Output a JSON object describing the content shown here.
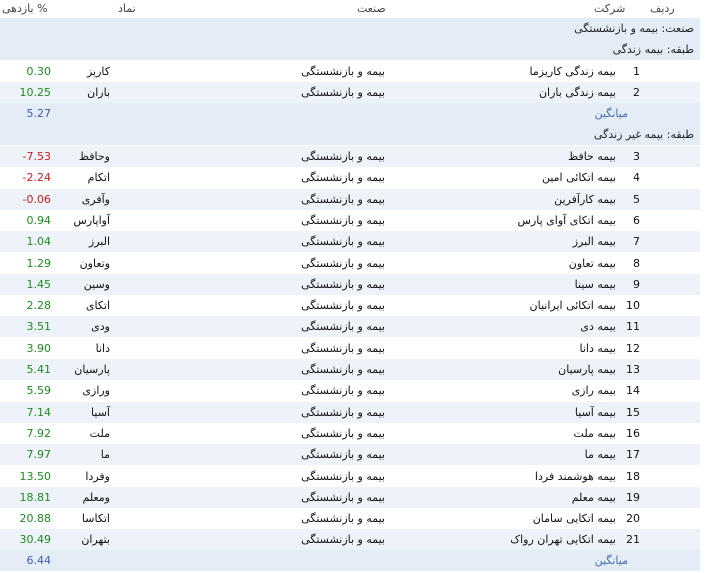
{
  "header": {
    "col_return": "بازدهی %",
    "col_symbol": "نماد",
    "col_industry": "صنعت",
    "col_company": "شرکت",
    "col_row": "ردیف"
  },
  "industry_group": "صنعت: بیمه و بازنشستگی",
  "class_life": "طبقه: بیمه زندگی",
  "class_nonlife": "طبقه: بیمه غیر زندگی",
  "average_label": "میانگین",
  "life_average": "5.27",
  "nonlife_average": "6.44",
  "industry_name": "بیمه و بازنشستگی",
  "life_rows": [
    {
      "no": "1",
      "company": "بیمه زندگی کاریزما",
      "symbol": "کاریز",
      "ret": "0.30",
      "sign": "pos"
    },
    {
      "no": "2",
      "company": "بیمه زندگی باران",
      "symbol": "باران",
      "ret": "10.25",
      "sign": "pos"
    }
  ],
  "nonlife_rows": [
    {
      "no": "3",
      "company": "بیمه حافظ",
      "symbol": "وحافظ",
      "ret": "-7.53",
      "sign": "neg"
    },
    {
      "no": "4",
      "company": "بیمه اتکائی امین",
      "symbol": "اتکام",
      "ret": "-2.24",
      "sign": "neg"
    },
    {
      "no": "5",
      "company": "بیمه کارآفرین",
      "symbol": "وآفری",
      "ret": "-0.06",
      "sign": "neg"
    },
    {
      "no": "6",
      "company": "بیمه اتکای آوای پارس",
      "symbol": "آواپارس",
      "ret": "0.94",
      "sign": "pos"
    },
    {
      "no": "7",
      "company": "بیمه البرز",
      "symbol": "البرز",
      "ret": "1.04",
      "sign": "pos"
    },
    {
      "no": "8",
      "company": "بیمه تعاون",
      "symbol": "وتعاون",
      "ret": "1.29",
      "sign": "pos"
    },
    {
      "no": "9",
      "company": "بیمه سینا",
      "symbol": "وسین",
      "ret": "1.45",
      "sign": "pos"
    },
    {
      "no": "10",
      "company": "بیمه اتکائی ایرانیان",
      "symbol": "اتکای",
      "ret": "2.28",
      "sign": "pos"
    },
    {
      "no": "11",
      "company": "بیمه دی",
      "symbol": "ودی",
      "ret": "3.51",
      "sign": "pos"
    },
    {
      "no": "12",
      "company": "بیمه دانا",
      "symbol": "دانا",
      "ret": "3.90",
      "sign": "pos"
    },
    {
      "no": "13",
      "company": "بیمه پارسیان",
      "symbol": "پارسیان",
      "ret": "5.41",
      "sign": "pos"
    },
    {
      "no": "14",
      "company": "بیمه رازی",
      "symbol": "ورازی",
      "ret": "5.59",
      "sign": "pos"
    },
    {
      "no": "15",
      "company": "بیمه آسیا",
      "symbol": "آسیا",
      "ret": "7.14",
      "sign": "pos"
    },
    {
      "no": "16",
      "company": "بیمه ملت",
      "symbol": "ملت",
      "ret": "7.92",
      "sign": "pos"
    },
    {
      "no": "17",
      "company": "بیمه ما",
      "symbol": "ما",
      "ret": "7.97",
      "sign": "pos"
    },
    {
      "no": "18",
      "company": "بیمه هوشمند فردا",
      "symbol": "وفردا",
      "ret": "13.50",
      "sign": "pos"
    },
    {
      "no": "19",
      "company": "بیمه معلم",
      "symbol": "ومعلم",
      "ret": "18.81",
      "sign": "pos"
    },
    {
      "no": "20",
      "company": "بیمه اتکایی سامان",
      "symbol": "اتکاسا",
      "ret": "20.88",
      "sign": "pos"
    },
    {
      "no": "21",
      "company": "بیمه اتکایی تهران رواک",
      "symbol": "بتهران",
      "ret": "30.49",
      "sign": "pos"
    }
  ]
}
